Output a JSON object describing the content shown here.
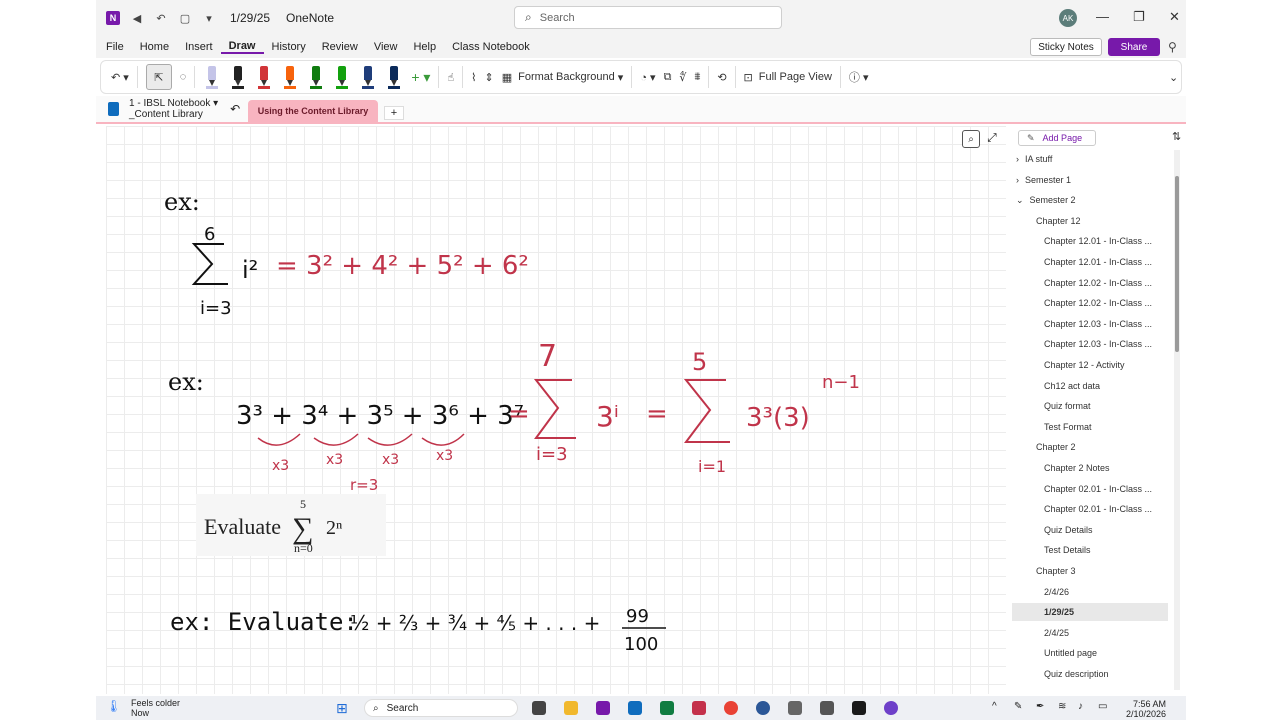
{
  "titlebar": {
    "doc_title": "1/29/25",
    "app_name": "OneNote",
    "search_placeholder": "Search",
    "avatar_initials": "AK"
  },
  "menu": {
    "items": [
      "File",
      "Home",
      "Insert",
      "Draw",
      "History",
      "Review",
      "View",
      "Help",
      "Class Notebook"
    ],
    "active": "Draw",
    "sticky_notes": "Sticky Notes",
    "share": "Share"
  },
  "ribbon": {
    "format_background": "Format Background",
    "full_page_view": "Full Page View",
    "pen_colors": [
      "#c4c4e8",
      "#222222",
      "#d13438",
      "#f7630c",
      "#107c10",
      "#13a10e",
      "#1f3d7a",
      "#0b2a5a"
    ]
  },
  "notebook": {
    "name": "1 - IBSL Notebook",
    "section": "_Content Library",
    "active_tab": "Using the Content Library"
  },
  "canvas": {
    "ex1_label": "ex:",
    "ex2_label": "ex:",
    "ex3_label": "ex: Evaluate:",
    "evaluate_text": "Evaluate",
    "ex1_sum_top": "6",
    "ex1_sum_bottom": "i=3",
    "ex1_rhs": "= 3² + 4² + 5² + 6²",
    "ex2_series": "3³ + 3⁴ + 3⁵ + 3⁶ + 3⁷",
    "ex2_ratio": "r=3",
    "times_three": "x3",
    "ex2_sum1_top": "7",
    "ex2_sum1_bottom": "i=3",
    "ex2_sum2_top": "5",
    "ex2_sum2_bottom": "i=1",
    "evaluate_sum_top": "5",
    "evaluate_sum_bottom": "n=0",
    "ex3_last_num": "99",
    "ex3_last_den": "100"
  },
  "pagelist": {
    "add_page": "Add Page",
    "items": [
      {
        "label": "IA stuff",
        "level": 0,
        "chevron": ">"
      },
      {
        "label": "Semester 1",
        "level": 0,
        "chevron": ">"
      },
      {
        "label": "Semester 2",
        "level": 0,
        "chevron": "v"
      },
      {
        "label": "Chapter 12",
        "level": 1
      },
      {
        "label": "Chapter 12.01 - In-Class ...",
        "level": 2
      },
      {
        "label": "Chapter 12.01 - In-Class ...",
        "level": 2
      },
      {
        "label": "Chapter 12.02 - In-Class ...",
        "level": 2
      },
      {
        "label": "Chapter 12.02 - In-Class ...",
        "level": 2
      },
      {
        "label": "Chapter 12.03 - In-Class ...",
        "level": 2
      },
      {
        "label": "Chapter 12.03 - In-Class ...",
        "level": 2
      },
      {
        "label": "Chapter 12 - Activity",
        "level": 2
      },
      {
        "label": "Ch12 act data",
        "level": 2
      },
      {
        "label": "Quiz format",
        "level": 2
      },
      {
        "label": "Test Format",
        "level": 2
      },
      {
        "label": "Chapter 2",
        "level": 1
      },
      {
        "label": "Chapter 2 Notes",
        "level": 2
      },
      {
        "label": "Chapter 02.01 - In-Class ...",
        "level": 2
      },
      {
        "label": "Chapter 02.01 - In-Class ...",
        "level": 2
      },
      {
        "label": "Quiz Details",
        "level": 2
      },
      {
        "label": "Test Details",
        "level": 2
      },
      {
        "label": "Chapter 3",
        "level": 1
      },
      {
        "label": "2/4/26",
        "level": 2
      },
      {
        "label": "1/29/25",
        "level": 2,
        "selected": true
      },
      {
        "label": "2/4/25",
        "level": 2
      },
      {
        "label": "Untitled page",
        "level": 2
      },
      {
        "label": "Quiz description",
        "level": 2
      }
    ]
  },
  "taskbar": {
    "weather": "Feels colder",
    "weather_sub": "Now",
    "search": "Search",
    "time": "7:56 AM",
    "date": "2/10/2026"
  }
}
